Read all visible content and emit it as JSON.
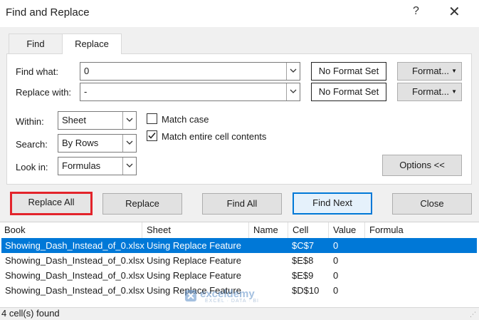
{
  "window": {
    "title": "Find and Replace",
    "help": "?",
    "close": "✕"
  },
  "tabs": [
    {
      "label": "Find"
    },
    {
      "label": "Replace"
    }
  ],
  "find": {
    "label": "Find what:",
    "value": "0",
    "format_status": "No Format Set",
    "format_button": "Format..."
  },
  "replace": {
    "label": "Replace with:",
    "value": "-",
    "format_status": "No Format Set",
    "format_button": "Format..."
  },
  "options": {
    "within": {
      "label": "Within:",
      "value": "Sheet"
    },
    "search": {
      "label": "Search:",
      "value": "By Rows"
    },
    "lookin": {
      "label": "Look in:",
      "value": "Formulas"
    },
    "match_case": {
      "label": "Match case",
      "checked": false
    },
    "match_entire": {
      "label": "Match entire cell contents",
      "checked": true
    },
    "options_button": "Options <<"
  },
  "actions": {
    "replace_all": "Replace All",
    "replace": "Replace",
    "find_all": "Find All",
    "find_next": "Find Next",
    "close": "Close"
  },
  "results": {
    "columns": [
      "Book",
      "Sheet",
      "Name",
      "Cell",
      "Value",
      "Formula"
    ],
    "rows": [
      {
        "book": "Showing_Dash_Instead_of_0.xlsx",
        "sheet": "Using Replace Feature",
        "name": "",
        "cell": "$C$7",
        "value": "0",
        "formula": "",
        "selected": true
      },
      {
        "book": "Showing_Dash_Instead_of_0.xlsx",
        "sheet": "Using Replace Feature",
        "name": "",
        "cell": "$E$8",
        "value": "0",
        "formula": ""
      },
      {
        "book": "Showing_Dash_Instead_of_0.xlsx",
        "sheet": "Using Replace Feature",
        "name": "",
        "cell": "$E$9",
        "value": "0",
        "formula": ""
      },
      {
        "book": "Showing_Dash_Instead_of_0.xlsx",
        "sheet": "Using Replace Feature",
        "name": "",
        "cell": "$D$10",
        "value": "0",
        "formula": ""
      }
    ]
  },
  "status": "4 cell(s) found",
  "watermark": {
    "name": "exceldemy",
    "tagline": "EXCEL · DATA · BI"
  },
  "colors": {
    "selection": "#0078d7",
    "highlight": "#e3242b",
    "dialog_bg": "#f0f0f0"
  }
}
